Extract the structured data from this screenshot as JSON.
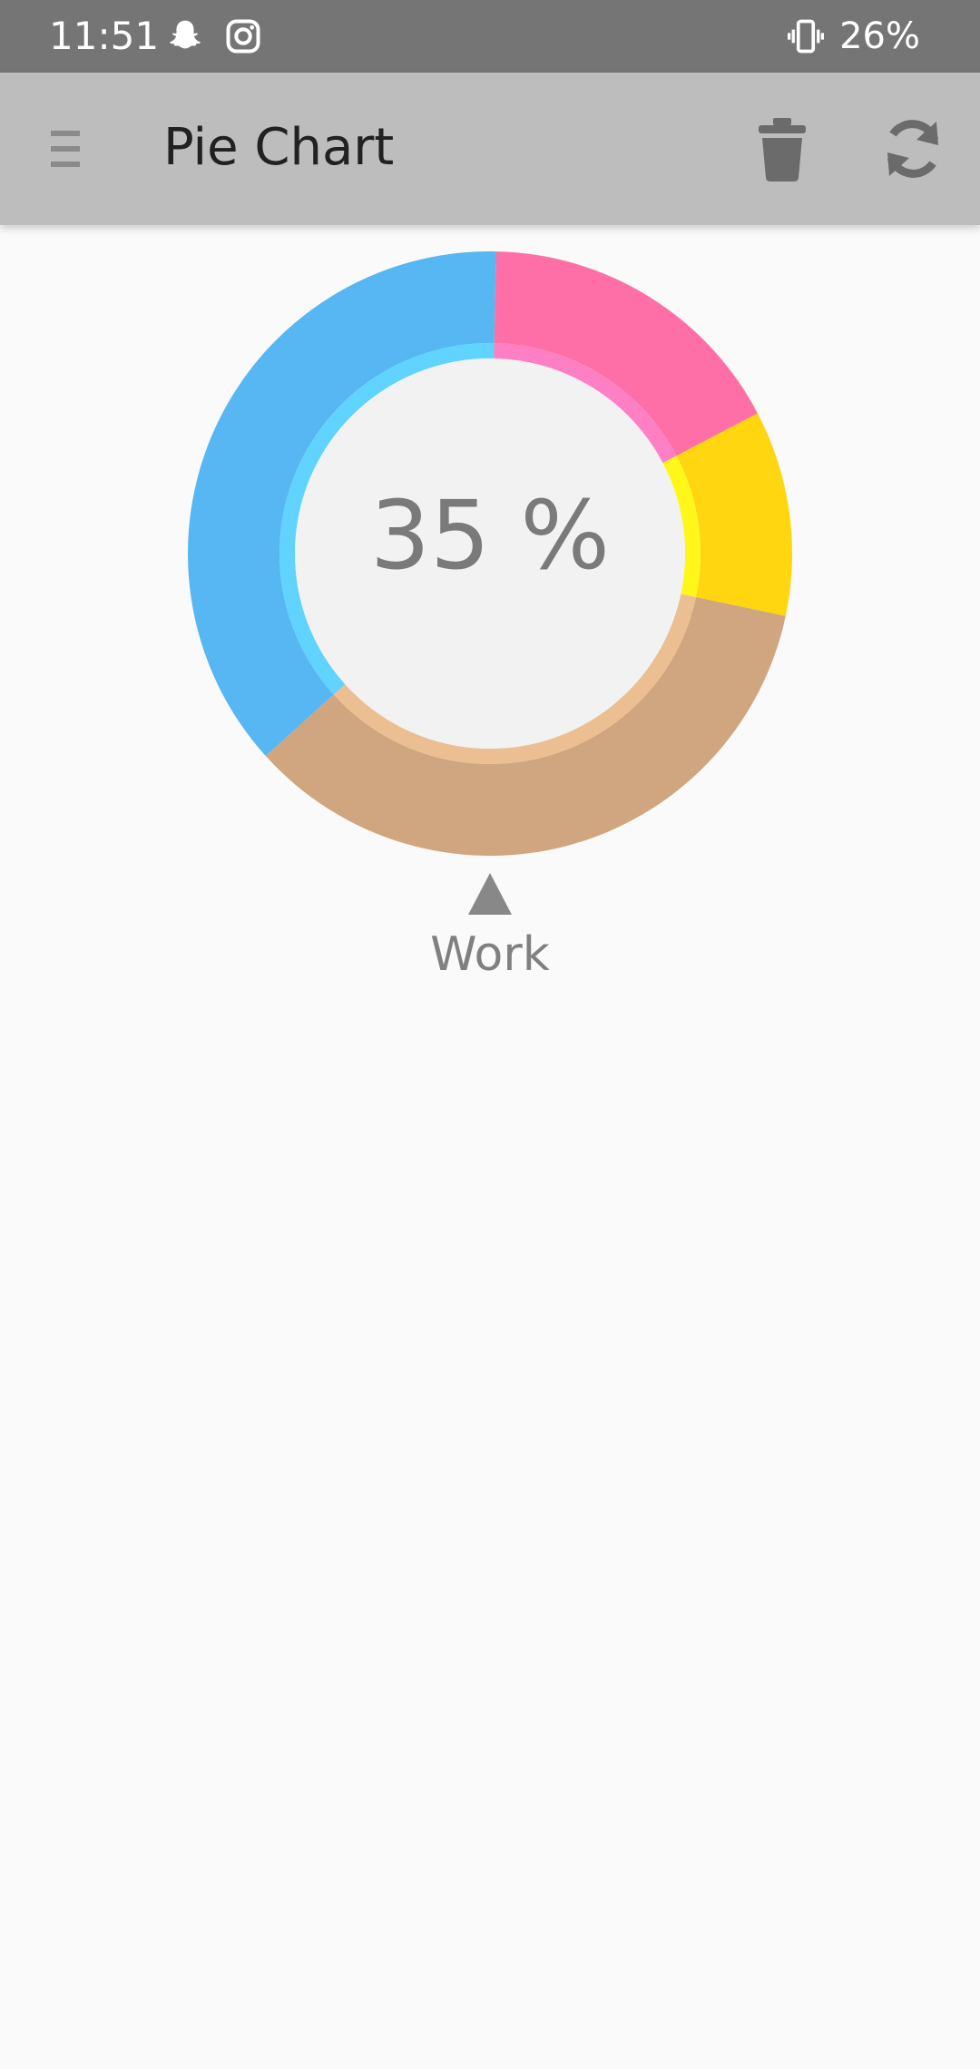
{
  "status_bar": {
    "time": "11:51",
    "battery": "26%",
    "icons": [
      "snapchat-icon",
      "instagram-icon",
      "vibrate-icon"
    ]
  },
  "app_bar": {
    "title": "Pie Chart",
    "icons": [
      "menu-icon",
      "trash-icon",
      "refresh-icon"
    ],
    "background_color": "#bdbdbd"
  },
  "chart": {
    "center_label": "35 %",
    "selected_label": "Work",
    "indicator_icon": "triangle-up-icon"
  },
  "chart_data": {
    "type": "pie",
    "style": "donut",
    "slices": [
      {
        "value": 17,
        "color": "#ff6fa7",
        "inner_color": "#ff7fc4"
      },
      {
        "value": 11,
        "color": "#ffd60f",
        "inner_color": "#fff71a"
      },
      {
        "value": 35,
        "color": "#cfa67f",
        "inner_color": "#ebbf92"
      },
      {
        "value": 37,
        "color": "#56b7f2",
        "inner_color": "#60d3ff"
      }
    ]
  }
}
